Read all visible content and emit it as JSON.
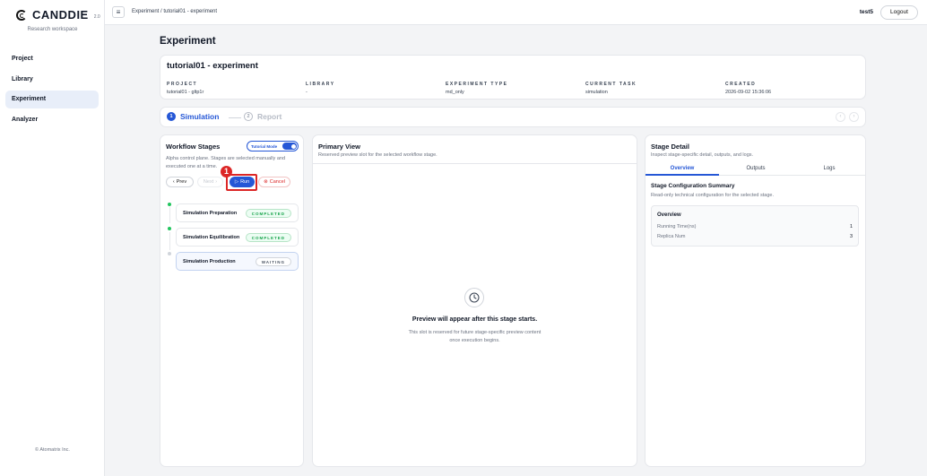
{
  "app": {
    "brand": "CANDDIE",
    "version": "2.0",
    "workspace": "Research workspace",
    "copyright": "© Atomatrix Inc."
  },
  "nav": {
    "items": [
      {
        "label": "Project"
      },
      {
        "label": "Library"
      },
      {
        "label": "Experiment",
        "active": true
      },
      {
        "label": "Analyzer"
      }
    ]
  },
  "topbar": {
    "breadcrumb": "Experiment / tutorial01 - experiment",
    "user": "test5",
    "logout_label": "Logout"
  },
  "page": {
    "title": "Experiment"
  },
  "experiment": {
    "name": "tutorial01 - experiment",
    "meta": [
      {
        "label": "PROJECT",
        "value": "tutorial01 - gltp1r"
      },
      {
        "label": "LIBRARY",
        "value": "-"
      },
      {
        "label": "EXPERIMENT TYPE",
        "value": "md_only"
      },
      {
        "label": "CURRENT TASK",
        "value": "simulation"
      },
      {
        "label": "CREATED",
        "value": "2026-09-02 15:36:06"
      }
    ]
  },
  "steps": [
    {
      "num": "1",
      "label": "Simulation",
      "active": true
    },
    {
      "num": "2",
      "label": "Report",
      "active": false
    }
  ],
  "workflow": {
    "title": "Workflow Stages",
    "tutorial_mode_label": "Tutorial Mode",
    "tutorial_mode_on": true,
    "description": "Alpha control plane. Stages are selected manually and executed one at a time.",
    "buttons": {
      "prev": "Prev",
      "next": "Next",
      "run": "Run",
      "cancel": "Cancel"
    },
    "annotation_badge": "1",
    "stages": [
      {
        "name": "Simulation Preparation",
        "status": "COMPLETED"
      },
      {
        "name": "Simulation Equilibration",
        "status": "COMPLETED"
      },
      {
        "name": "Simulation Production",
        "status": "WAITING"
      }
    ]
  },
  "primary_view": {
    "title": "Primary View",
    "subtitle": "Reserved preview slot for the selected workflow stage.",
    "message": "Preview will appear after this stage starts.",
    "note_line1": "This slot is reserved for future stage-specific preview content",
    "note_line2": "once execution begins."
  },
  "stage_detail": {
    "title": "Stage Detail",
    "subtitle": "Inspect stage-specific detail, outputs, and logs.",
    "tabs": [
      {
        "label": "Overview",
        "active": true
      },
      {
        "label": "Outputs"
      },
      {
        "label": "Logs"
      }
    ],
    "config_title": "Stage Configuration Summary",
    "config_subtitle": "Read-only technical configuration for the selected stage.",
    "overview": {
      "title": "Overview",
      "rows": [
        {
          "key": "Running Time(ns)",
          "value": "1"
        },
        {
          "key": "Replica Num",
          "value": "3"
        }
      ]
    }
  },
  "colors": {
    "accent": "#2557d6",
    "danger": "#dc2626",
    "success": "#16a34a"
  }
}
